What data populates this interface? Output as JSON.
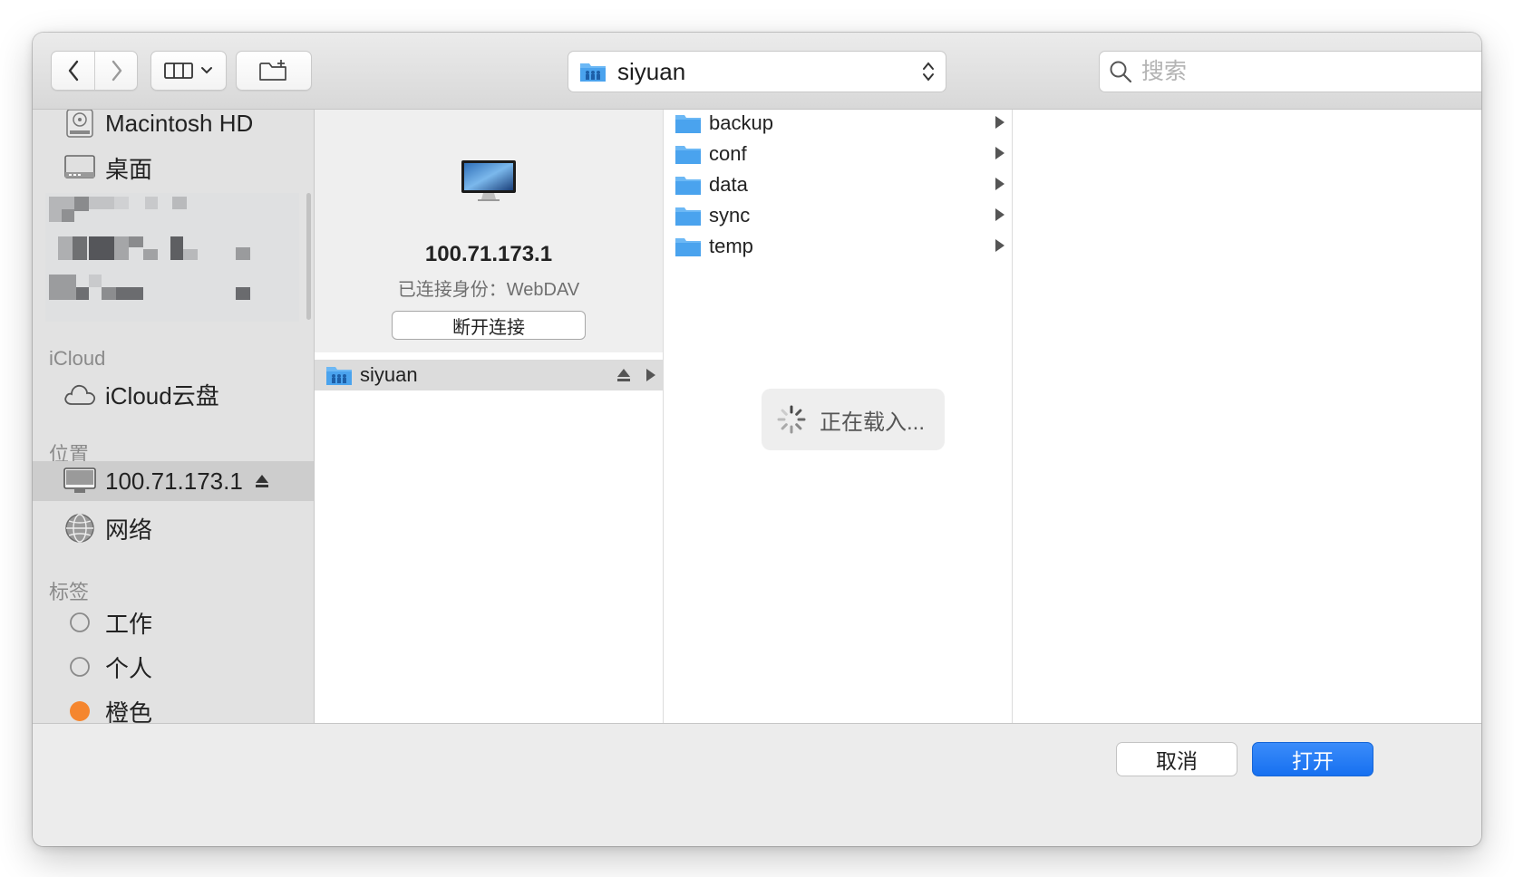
{
  "toolbar": {
    "path_label": "siyuan",
    "search_placeholder": "搜索"
  },
  "sidebar": {
    "items_top": [
      {
        "label": "Macintosh HD",
        "icon": "hard-drive-icon"
      },
      {
        "label": "桌面",
        "icon": "desktop-icon"
      }
    ],
    "icloud_header": "iCloud",
    "icloud_items": [
      {
        "label": "iCloud云盘",
        "icon": "cloud-icon"
      }
    ],
    "locations_header": "位置",
    "location_items": [
      {
        "label": "100.71.173.1",
        "icon": "monitor-icon",
        "selected": true,
        "eject": true
      },
      {
        "label": "网络",
        "icon": "network-globe-icon"
      }
    ],
    "tags_header": "标签",
    "tag_items": [
      {
        "label": "工作",
        "color": "none"
      },
      {
        "label": "个人",
        "color": "none"
      },
      {
        "label": "橙色",
        "color": "#f5862f"
      }
    ]
  },
  "server": {
    "name": "100.71.173.1",
    "status": "已连接身份：WebDAV",
    "disconnect_label": "断开连接",
    "share_label": "siyuan"
  },
  "folders": [
    {
      "label": "backup"
    },
    {
      "label": "conf"
    },
    {
      "label": "data"
    },
    {
      "label": "sync"
    },
    {
      "label": "temp"
    }
  ],
  "loading_text": "正在载入...",
  "footer": {
    "cancel_label": "取消",
    "open_label": "打开"
  },
  "colors": {
    "accent": "#1770f0",
    "folder": "#5fb3f5",
    "orange_tag": "#f5862f"
  }
}
